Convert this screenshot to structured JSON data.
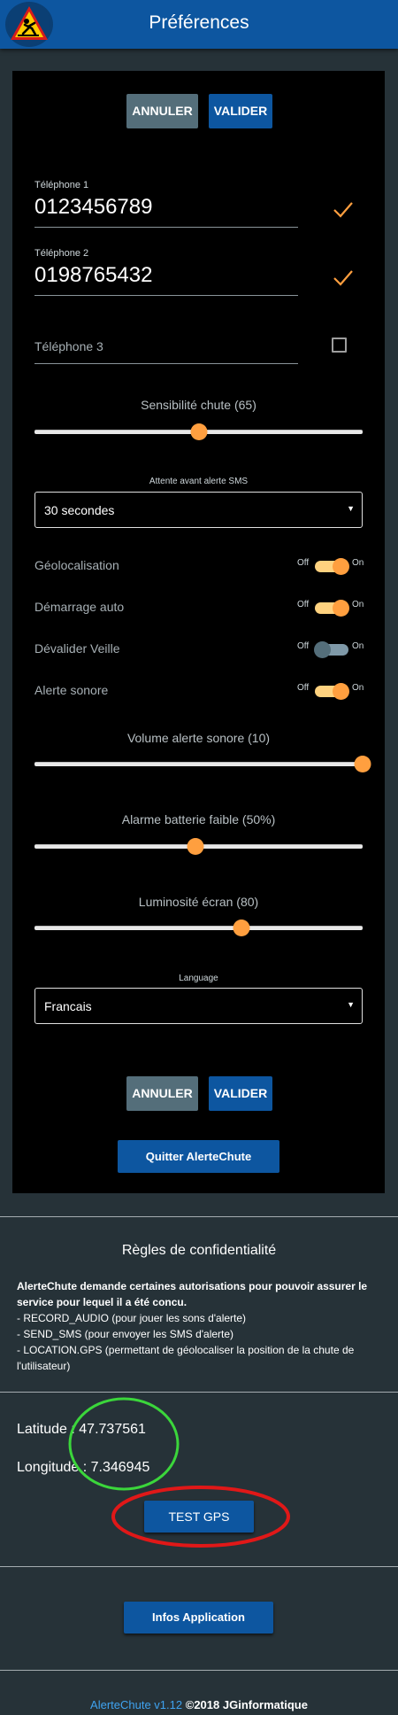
{
  "header": {
    "title": "Préférences",
    "logo_icon": "warning-fall-icon"
  },
  "top_buttons": {
    "cancel": "ANNULER",
    "ok": "VALIDER"
  },
  "phones": [
    {
      "label": "Téléphone 1",
      "value": "0123456789",
      "checked": true
    },
    {
      "label": "Téléphone 2",
      "value": "0198765432",
      "checked": true
    },
    {
      "label": "",
      "placeholder": "Téléphone 3",
      "checked": false
    }
  ],
  "sliders": {
    "fall_sensitivity": {
      "title": "Sensibilité chute (65)",
      "value": 65
    },
    "alert_volume": {
      "title": "Volume alerte sonore (10)",
      "value": 10,
      "max": 10
    },
    "battery_alarm": {
      "title": "Alarme batterie faible (50%)",
      "value": 50
    },
    "brightness": {
      "title": "Luminosité écran (80)",
      "value": 80
    }
  },
  "sms_delay": {
    "label": "Attente avant alerte SMS",
    "value": "30 secondes"
  },
  "toggles": [
    {
      "label": "Géolocalisation",
      "off": "Off",
      "on": "On",
      "state": true
    },
    {
      "label": "Démarrage auto",
      "off": "Off",
      "on": "On",
      "state": true
    },
    {
      "label": "Dévalider Veille",
      "off": "Off",
      "on": "On",
      "state": false
    },
    {
      "label": "Alerte sonore",
      "off": "Off",
      "on": "On",
      "state": true
    }
  ],
  "language": {
    "label": "Language",
    "value": "Francais"
  },
  "bottom_buttons": {
    "cancel": "ANNULER",
    "ok": "VALIDER",
    "quit": "Quitter AlerteChute"
  },
  "privacy": {
    "title": "Règles de confidentialité",
    "intro": "AlerteChute demande certaines autorisations pour pouvoir assurer le service pour lequel il a été concu.",
    "items": [
      "- RECORD_AUDIO (pour jouer les sons d'alerte)",
      "- SEND_SMS (pour envoyer les SMS d'alerte)",
      "- LOCATION.GPS (permettant de géolocaliser la position de la chute de l'utilisateur)"
    ]
  },
  "gps": {
    "latitude_label": "Latitude :",
    "latitude": "47.737561",
    "longitude_label": "Longitude :",
    "longitude": "7.346945",
    "test_button": "TEST GPS"
  },
  "info_button": "Infos Application",
  "footer": {
    "app_version": "AlerteChute v1.12",
    "copyright": "©2018 JGinformatique"
  },
  "colors": {
    "header": "#0d56a0",
    "background": "#263238",
    "panel": "#000000",
    "accent": "#ff9f3f",
    "button_blue": "#0d56a0",
    "button_grey": "#546e7a",
    "annotation_green": "#3bd63b",
    "annotation_red": "#e01818"
  }
}
